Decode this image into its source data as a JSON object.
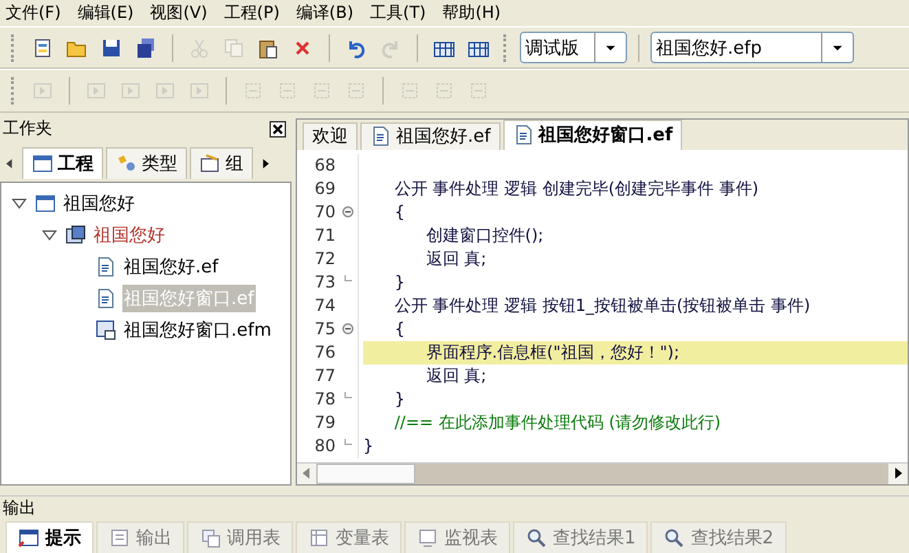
{
  "menu": [
    {
      "label": "文件(F)"
    },
    {
      "label": "编辑(E)"
    },
    {
      "label": "视图(V)"
    },
    {
      "label": "工程(P)"
    },
    {
      "label": "编译(B)"
    },
    {
      "label": "工具(T)"
    },
    {
      "label": "帮助(H)"
    }
  ],
  "toolbar": {
    "groups": [
      [
        {
          "kind": "new",
          "disabled": false
        },
        {
          "kind": "open",
          "disabled": false
        },
        {
          "kind": "save",
          "disabled": false
        },
        {
          "kind": "saveall",
          "disabled": false
        }
      ],
      [
        {
          "kind": "cut",
          "disabled": true
        },
        {
          "kind": "copy",
          "disabled": true
        },
        {
          "kind": "paste",
          "disabled": false
        },
        {
          "kind": "delete",
          "disabled": false
        }
      ],
      [
        {
          "kind": "undo",
          "disabled": false
        },
        {
          "kind": "redo",
          "disabled": true
        }
      ],
      [
        {
          "kind": "grid",
          "disabled": false
        },
        {
          "kind": "grid",
          "disabled": false
        }
      ]
    ],
    "combos": [
      {
        "value": "调试版"
      },
      {
        "value": "祖国您好.efp"
      }
    ]
  },
  "layout_toolbar": {
    "groups": [
      [
        {
          "kind": "align",
          "disabled": true
        }
      ],
      [
        {
          "kind": "align",
          "disabled": true
        },
        {
          "kind": "align",
          "disabled": true
        },
        {
          "kind": "align",
          "disabled": true
        },
        {
          "kind": "align",
          "disabled": true
        }
      ],
      [
        {
          "kind": "space",
          "disabled": true
        },
        {
          "kind": "space",
          "disabled": true
        },
        {
          "kind": "space",
          "disabled": true
        },
        {
          "kind": "space",
          "disabled": true
        }
      ],
      [
        {
          "kind": "space",
          "disabled": true
        },
        {
          "kind": "space",
          "disabled": true
        },
        {
          "kind": "space",
          "disabled": true
        }
      ]
    ]
  },
  "workspace": {
    "title": "工作夹",
    "tabs": [
      {
        "label": "工程",
        "kind": "project",
        "selected": true
      },
      {
        "label": "类型",
        "kind": "types",
        "selected": false
      },
      {
        "label": "组",
        "kind": "components",
        "selected": false
      }
    ],
    "tree": [
      {
        "label": "祖国您好",
        "kind": "project",
        "expanded": true,
        "active": false,
        "selected": false,
        "children": [
          {
            "label": "祖国您好",
            "kind": "module",
            "expanded": true,
            "active": true,
            "selected": false,
            "children": [
              {
                "label": "祖国您好.ef",
                "kind": "file",
                "active": false,
                "selected": false
              },
              {
                "label": "祖国您好窗口.ef",
                "kind": "file",
                "active": false,
                "selected": true
              },
              {
                "label": "祖国您好窗口.efm",
                "kind": "form",
                "active": false,
                "selected": false
              }
            ]
          }
        ]
      }
    ]
  },
  "editor": {
    "tabs": [
      {
        "label": "欢迎",
        "kind": "plain",
        "selected": false
      },
      {
        "label": "祖国您好.ef",
        "kind": "file",
        "selected": false
      },
      {
        "label": "祖国您好窗口.ef",
        "kind": "file",
        "selected": true
      }
    ],
    "lines": [
      {
        "number": "68",
        "kind": "code",
        "collapsible": false,
        "block_end": false,
        "highlighted": false
      },
      {
        "number": "69",
        "text": "      公开 事件处理 逻辑 创建完毕(创建完毕事件 事件)",
        "kind": "code",
        "collapsible": false,
        "block_end": false,
        "highlighted": false
      },
      {
        "number": "70",
        "text": "      {",
        "kind": "code",
        "collapsible": true,
        "block_end": false,
        "highlighted": false
      },
      {
        "number": "71",
        "text": "            创建窗口控件();",
        "kind": "code",
        "collapsible": false,
        "block_end": false,
        "highlighted": false
      },
      {
        "number": "72",
        "text": "            返回 真;",
        "kind": "code",
        "collapsible": false,
        "block_end": false,
        "highlighted": false
      },
      {
        "number": "73",
        "text": "      }",
        "kind": "code",
        "collapsible": false,
        "block_end": true,
        "highlighted": false
      },
      {
        "number": "74",
        "text": "      公开 事件处理 逻辑 按钮1_按钮被单击(按钮被单击 事件)",
        "kind": "code",
        "collapsible": false,
        "block_end": false,
        "highlighted": false
      },
      {
        "number": "75",
        "text": "      {",
        "kind": "code",
        "collapsible": true,
        "block_end": false,
        "highlighted": false
      },
      {
        "number": "76",
        "text": "            界面程序.信息框(\"祖国，您好！\");",
        "kind": "code",
        "collapsible": false,
        "block_end": false,
        "highlighted": true
      },
      {
        "number": "77",
        "text": "            返回 真;",
        "kind": "code",
        "collapsible": false,
        "block_end": false,
        "highlighted": false
      },
      {
        "number": "78",
        "text": "      }",
        "kind": "code",
        "collapsible": false,
        "block_end": true,
        "highlighted": false
      },
      {
        "number": "79",
        "text": "      //== 在此添加事件处理代码 (请勿修改此行)",
        "kind": "comment",
        "collapsible": false,
        "block_end": false,
        "highlighted": false
      },
      {
        "number": "80",
        "text": "}",
        "kind": "code",
        "collapsible": false,
        "block_end": true,
        "highlighted": false
      }
    ]
  },
  "output": {
    "title": "输出",
    "tabs": [
      {
        "label": "提示",
        "kind": "tip",
        "selected": true
      },
      {
        "label": "输出",
        "kind": "output",
        "selected": false
      },
      {
        "label": "调用表",
        "kind": "calls",
        "selected": false
      },
      {
        "label": "变量表",
        "kind": "vars",
        "selected": false
      },
      {
        "label": "监视表",
        "kind": "watch",
        "selected": false
      },
      {
        "label": "查找结果1",
        "kind": "find",
        "selected": false
      },
      {
        "label": "查找结果2",
        "kind": "find",
        "selected": false
      }
    ]
  }
}
